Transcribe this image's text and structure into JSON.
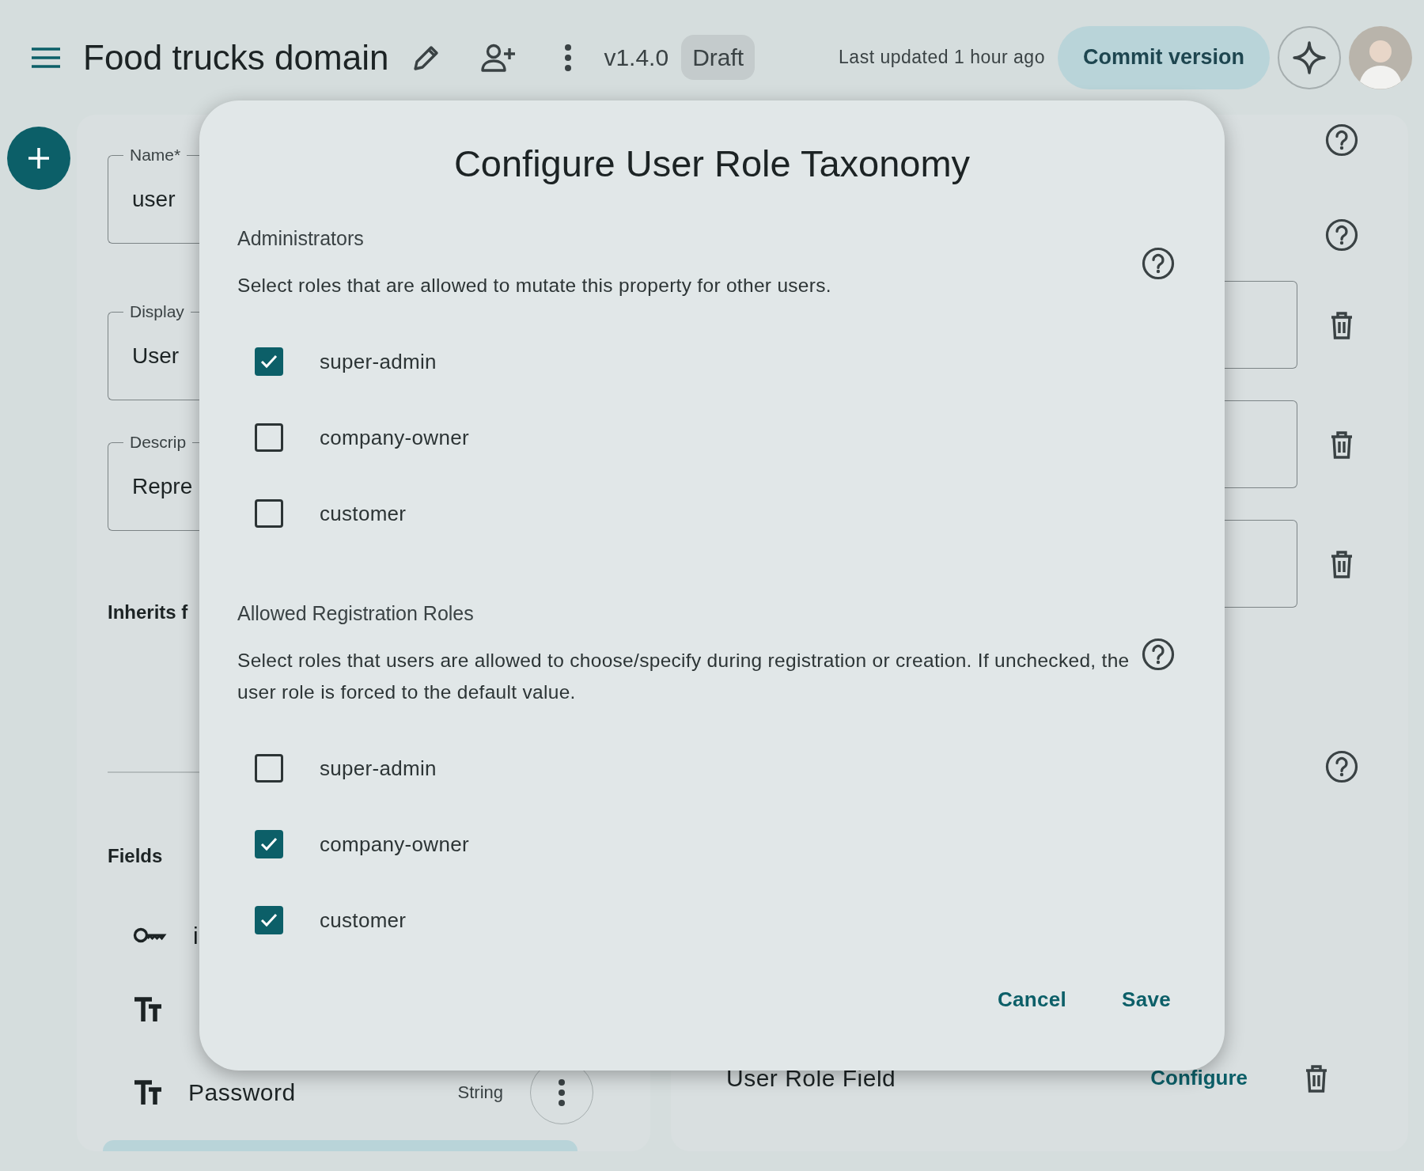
{
  "header": {
    "title": "Food trucks domain",
    "version": "v1.4.0",
    "status": "Draft",
    "last_updated": "Last updated 1 hour ago",
    "commit_button": "Commit version"
  },
  "entity_form": {
    "inputs": [
      {
        "label": "Name*",
        "value": "user"
      },
      {
        "label": "Display",
        "value": "User"
      },
      {
        "label": "Descrip",
        "value": "Repre"
      }
    ],
    "inherits_heading": "Inherits f",
    "fields_heading": "Fields",
    "field_rows": [
      {
        "kind": "key",
        "name": "i"
      },
      {
        "kind": "text"
      },
      {
        "kind": "text",
        "name": "Password",
        "type": "String"
      }
    ]
  },
  "right_panel": {
    "role_field": {
      "label": "User Role Field",
      "action": "Configure"
    }
  },
  "dialog": {
    "title": "Configure User Role Taxonomy",
    "sections": [
      {
        "label": "Administrators",
        "description": "Select roles that are allowed to mutate this property for other users.",
        "roles": [
          {
            "name": "super-admin",
            "checked": true
          },
          {
            "name": "company-owner",
            "checked": false
          },
          {
            "name": "customer",
            "checked": false
          }
        ]
      },
      {
        "label": "Allowed Registration Roles",
        "description": "Select roles that users are allowed to choose/specify during registration or creation. If unchecked, the user role is forced to the default value.",
        "roles": [
          {
            "name": "super-admin",
            "checked": false
          },
          {
            "name": "company-owner",
            "checked": true
          },
          {
            "name": "customer",
            "checked": true
          }
        ]
      }
    ],
    "buttons": [
      "Cancel",
      "Save"
    ]
  }
}
